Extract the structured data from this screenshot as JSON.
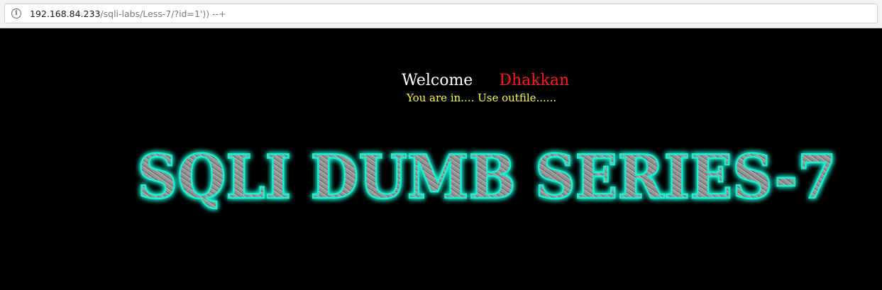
{
  "browser": {
    "url_host": "192.168.84.233",
    "url_path": "/sqli-labs/Less-7/?id=1')) --+",
    "info_icon": "info-icon"
  },
  "page": {
    "welcome_label": "Welcome",
    "welcome_user": "Dhakkan",
    "status_message": "You are in.... Use outfile......",
    "banner_text": "SQLI DUMB SERIES-7",
    "colors": {
      "background": "#000000",
      "welcome": "#ffffff",
      "user": "#ff1a1a",
      "status": "#ffff33",
      "banner_glow": "#19e6c8",
      "banner_fill": "#8a8a8a"
    }
  }
}
